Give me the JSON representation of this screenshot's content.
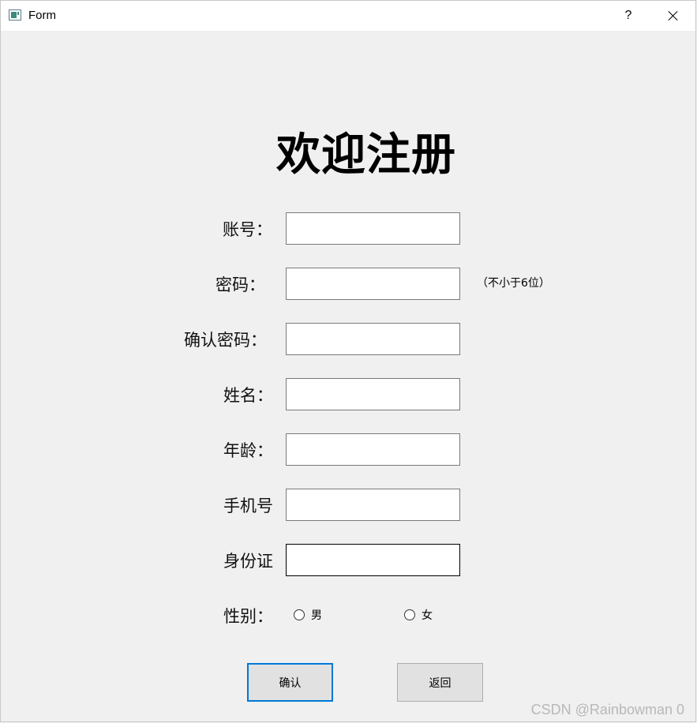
{
  "window": {
    "title": "Form",
    "help_label": "?"
  },
  "heading": "欢迎注册",
  "fields": [
    {
      "label": "账号：",
      "value": ""
    },
    {
      "label": "密码：",
      "value": ""
    },
    {
      "label": "确认密码：",
      "value": ""
    },
    {
      "label": "姓名：",
      "value": ""
    },
    {
      "label": "年龄：",
      "value": ""
    },
    {
      "label": "手机号",
      "value": ""
    },
    {
      "label": "身份证",
      "value": ""
    }
  ],
  "password_hint": "（不小于6位）",
  "gender": {
    "label": "性别：",
    "options": [
      "男",
      "女"
    ],
    "selected": null
  },
  "buttons": {
    "confirm": "确认",
    "back": "返回"
  },
  "watermark": "CSDN @Rainbowman 0",
  "colors": {
    "window_bg": "#f0f0f0",
    "default_button_border": "#0078d7",
    "button_bg": "#e1e1e1"
  }
}
